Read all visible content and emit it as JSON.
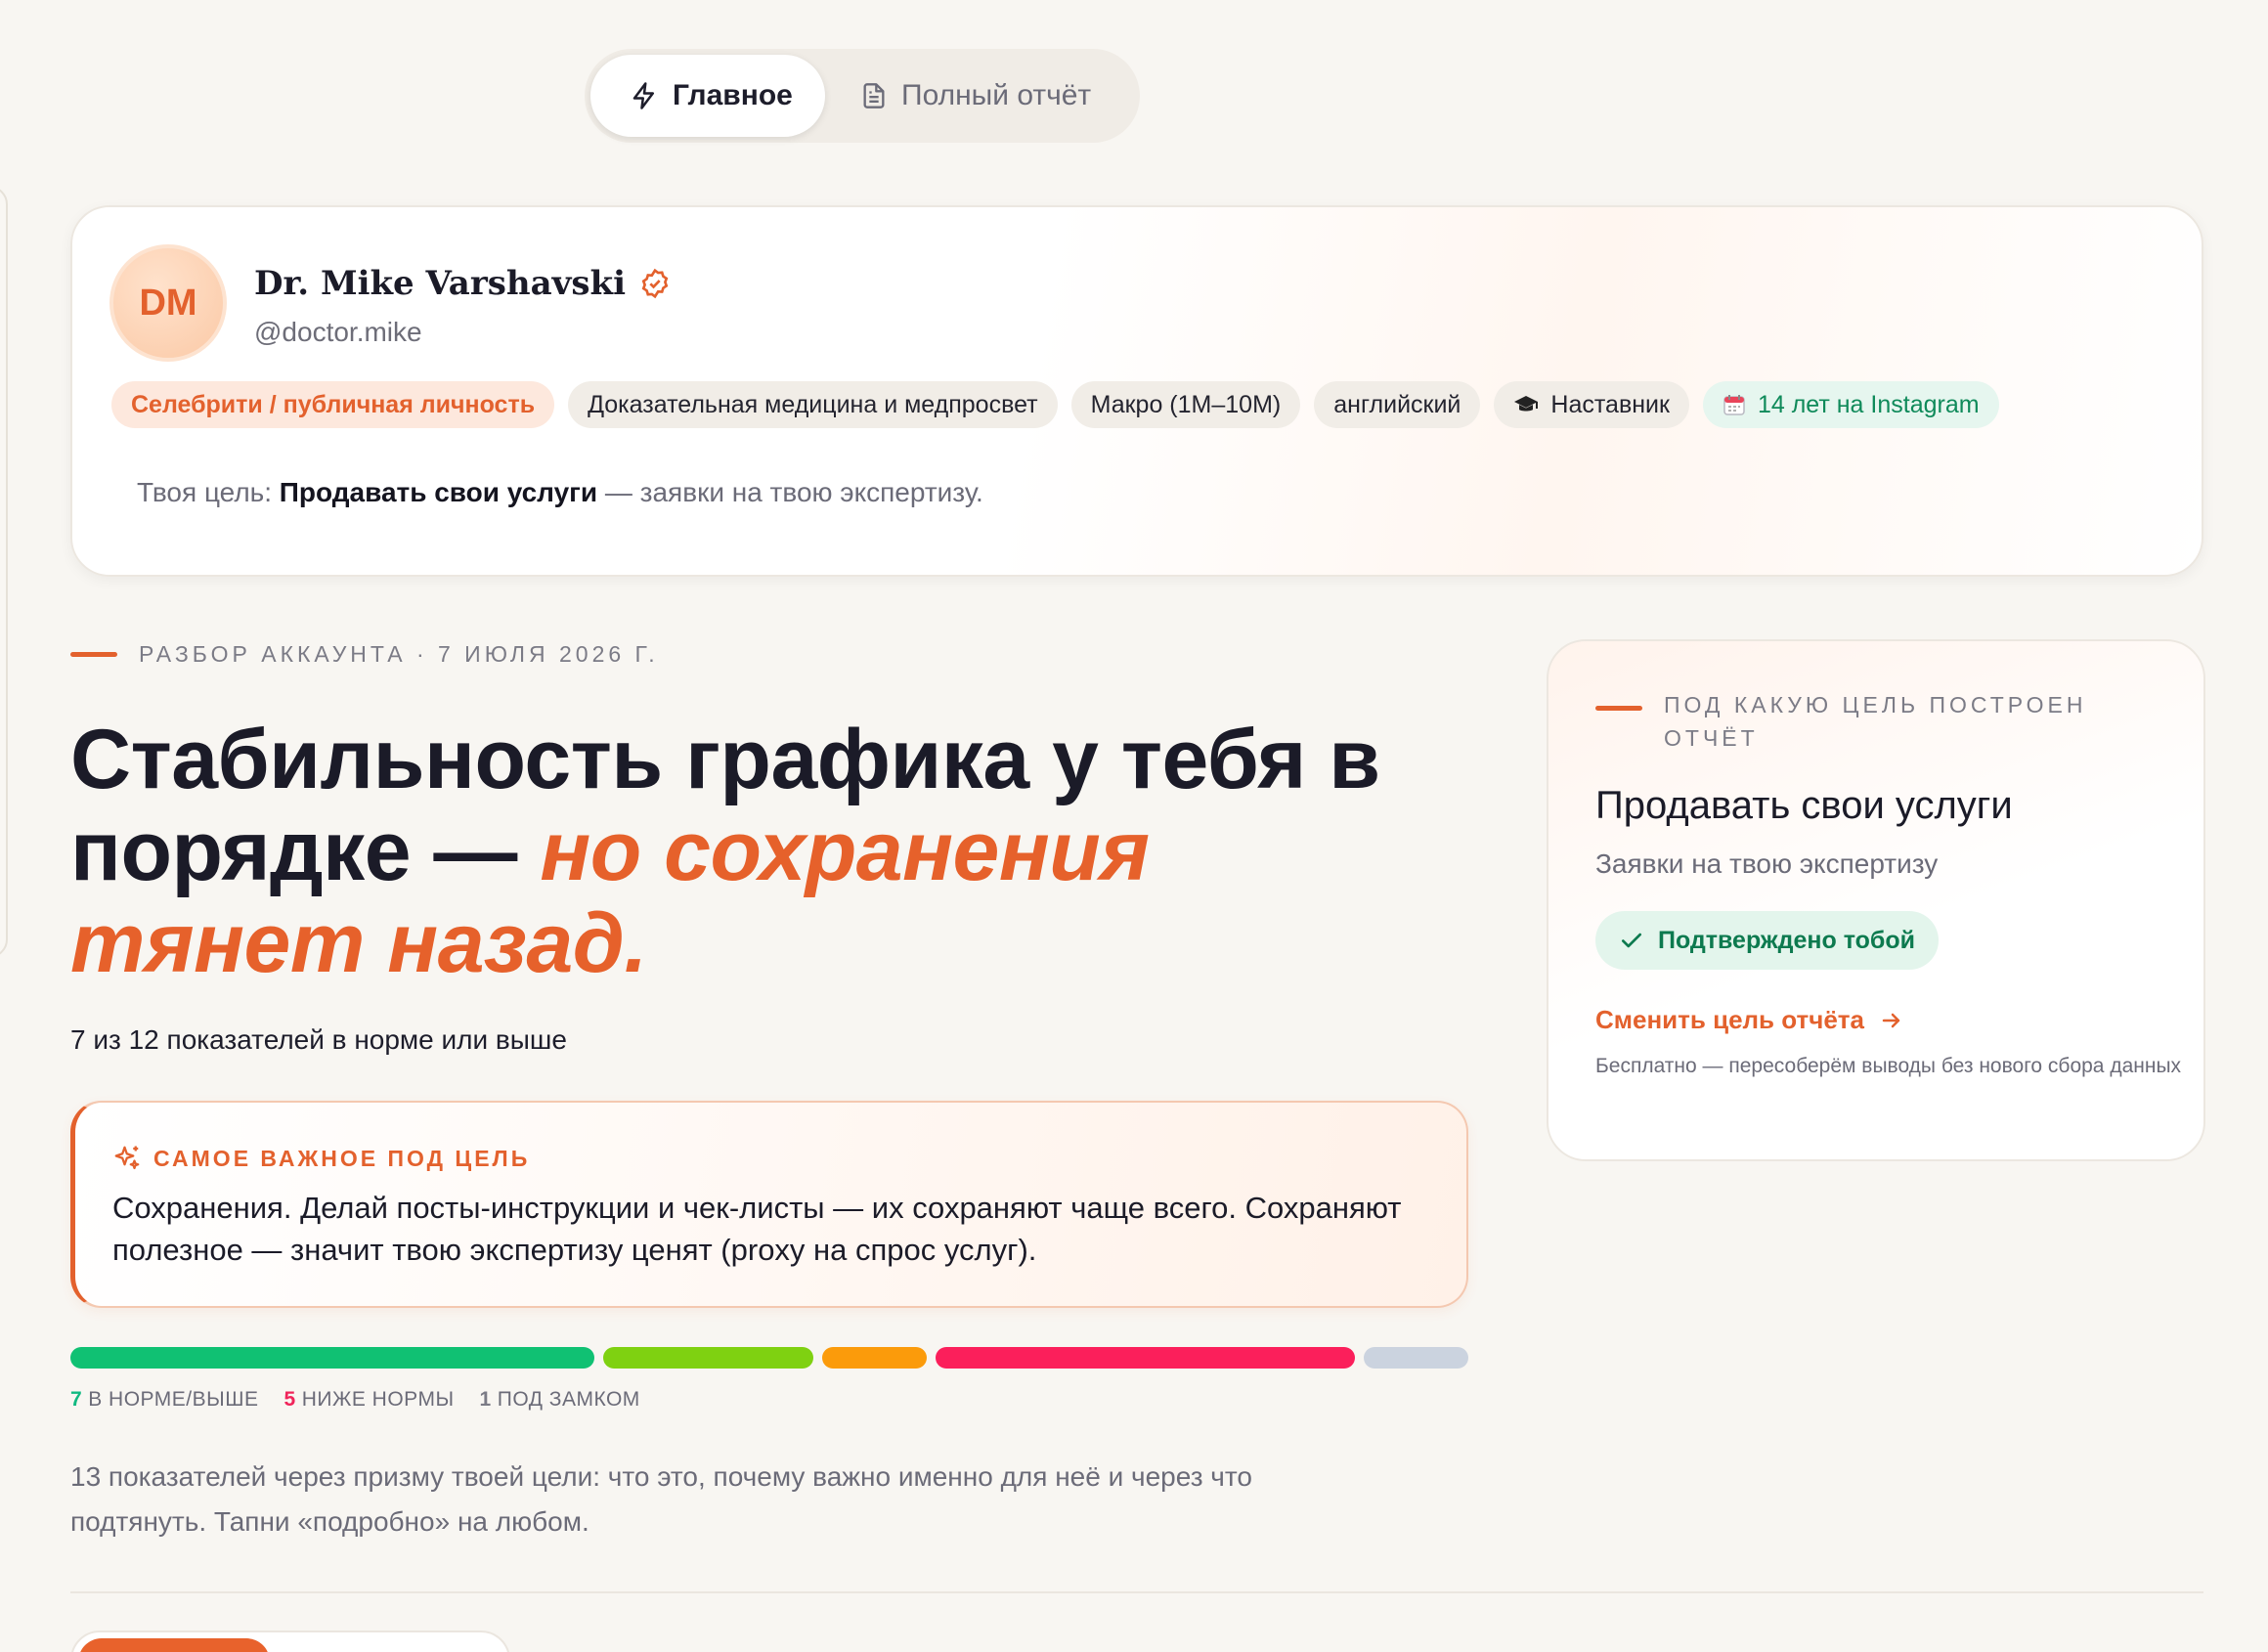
{
  "tabs": [
    {
      "label": "Главное",
      "icon": "lightning-icon",
      "active": true
    },
    {
      "label": "Полный отчёт",
      "icon": "document-icon",
      "active": false
    }
  ],
  "profile": {
    "initials": "DM",
    "name": "Dr. Mike Varshavski",
    "handle": "@doctor.mike",
    "chips": [
      {
        "label": "Селебрити / публичная личность",
        "style": "accent"
      },
      {
        "label": "Доказательная медицина и медпросвет",
        "style": "neutral"
      },
      {
        "label": "Макро (1M–10M)",
        "style": "neutral"
      },
      {
        "label": "английский",
        "style": "neutral"
      },
      {
        "label": "Наставник",
        "style": "neutral",
        "icon": "graduation-cap-icon"
      },
      {
        "label": "14 лет на Instagram",
        "style": "green",
        "icon": "calendar-icon"
      }
    ],
    "goal_prefix": "Твоя цель: ",
    "goal_value": "Продавать свои услуги",
    "goal_suffix": " — заявки на твою экспертизу."
  },
  "review": {
    "eyebrow": "РАЗБОР АККАУНТА · 7 ИЮЛЯ 2026 Г.",
    "headline_plain": "Стабильность графика у тебя в порядке — ",
    "headline_accent": "но сохранения тянет назад.",
    "subline": "7 из 12 показателей в норме или выше",
    "insight_label": "САМОЕ ВАЖНОЕ ПОД ЦЕЛЬ",
    "insight_text": "Сохранения. Делай посты-инструкции и чек-листы — их сохраняют чаще всего. Сохраняют полезное — значит твою экспертизу ценят (proxy на спрос услуг).",
    "legend": [
      {
        "count": "7",
        "label": "В НОРМЕ/ВЫШЕ",
        "color": "#10b981"
      },
      {
        "count": "5",
        "label": "НИЖЕ НОРМЫ",
        "color": "#f0245a"
      },
      {
        "count": "1",
        "label": "ПОД ЗАМКОМ",
        "color": "#7b7b86"
      }
    ],
    "status_bar": [
      {
        "share": 5,
        "color": "#10c173"
      },
      {
        "share": 2,
        "color": "#7fd111"
      },
      {
        "share": 1,
        "color": "#fb9b0b"
      },
      {
        "share": 4,
        "color": "#fb1f5b"
      },
      {
        "share": 1,
        "color": "#cbd3df"
      }
    ],
    "description": "13 показателей через призму твоей цели: что это, почему важно именно для неё и через что подтянуть. Тапни «подробно» на любом."
  },
  "goal_card": {
    "eyebrow": "ПОД КАКУЮ ЦЕЛЬ ПОСТРОЕН ОТЧЁТ",
    "title": "Продавать свои услуги",
    "subtitle": "Заявки на твою экспертизу",
    "badge": "Подтверждено тобой",
    "change_link": "Сменить цель отчёта",
    "note": "Бесплатно — пересоберём выводы без нового сбора данных"
  },
  "colors": {
    "accent": "#e3612d",
    "success": "#0f8a5a",
    "background": "#f8f6f2"
  }
}
